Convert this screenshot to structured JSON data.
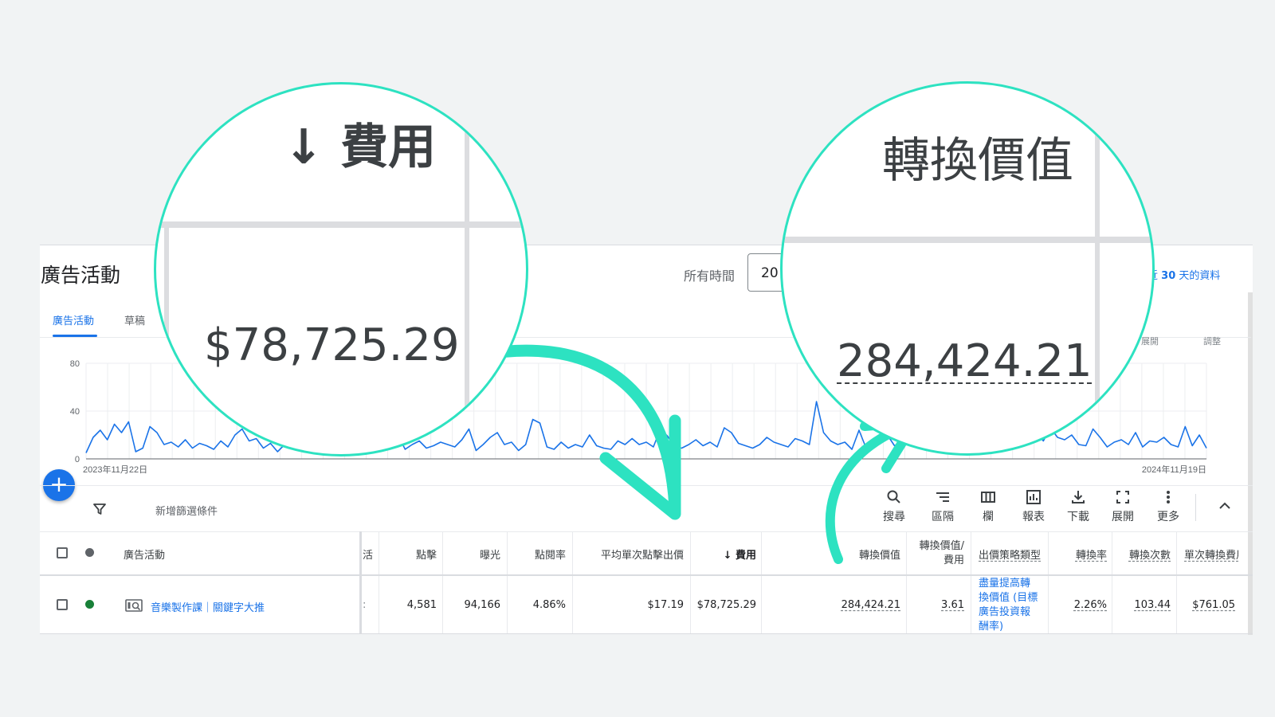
{
  "header": {
    "title": "廣告活動",
    "date_label": "所有時間",
    "date_value": "20",
    "data_note_prefix": "近",
    "data_note_days": "30",
    "data_note_suffix": "天的資料"
  },
  "tabs": [
    {
      "label": "廣告活動",
      "active": true
    },
    {
      "label": "草稿",
      "active": false
    }
  ],
  "chart_hints": [
    "展開",
    "調整"
  ],
  "chart_data": {
    "type": "line",
    "yticks": [
      "80",
      "40",
      "0"
    ],
    "ylim": [
      0,
      80
    ],
    "x_start_label": "2023年11月22日",
    "x_end_label": "2024年11月19日",
    "series_color": "#1a73e8",
    "series": [
      {
        "values": [
          5,
          18,
          24,
          16,
          29,
          22,
          31,
          6,
          9,
          27,
          22,
          12,
          14,
          10,
          16,
          9,
          13,
          11,
          8,
          15,
          10,
          20,
          25,
          15,
          17,
          9,
          13,
          6,
          12,
          26,
          29,
          27,
          10,
          8,
          11,
          15,
          12,
          9,
          14,
          10,
          16,
          12,
          11,
          13,
          20,
          8,
          12,
          15,
          9,
          11,
          14,
          12,
          10,
          16,
          25,
          7,
          12,
          18,
          22,
          12,
          14,
          7,
          12,
          33,
          30,
          10,
          8,
          14,
          9,
          12,
          10,
          20,
          11,
          9,
          8,
          15,
          12,
          17,
          12,
          14,
          10,
          25,
          19,
          10,
          9,
          12,
          16,
          11,
          14,
          10,
          26,
          22,
          13,
          11,
          9,
          12,
          18,
          14,
          12,
          10,
          17,
          15,
          12,
          48,
          22,
          15,
          12,
          14,
          8,
          24,
          9,
          12,
          13,
          20,
          11,
          14,
          16,
          27,
          21,
          19,
          9,
          15,
          25,
          17,
          14,
          10,
          12,
          20,
          14,
          8,
          13,
          35,
          24,
          18,
          22,
          15,
          26,
          18,
          16,
          20,
          12,
          11,
          25,
          18,
          10,
          14,
          16,
          12,
          22,
          10,
          15,
          14,
          18,
          12,
          10,
          27,
          11,
          20,
          9
        ]
      }
    ]
  },
  "fab_label": "+",
  "filter": {
    "label": "新增篩選條件"
  },
  "toolbar": [
    {
      "label": "搜尋",
      "icon": "search-icon"
    },
    {
      "label": "區隔",
      "icon": "segment-icon"
    },
    {
      "label": "欄",
      "icon": "columns-icon"
    },
    {
      "label": "報表",
      "icon": "reports-icon"
    },
    {
      "label": "下載",
      "icon": "download-icon"
    },
    {
      "label": "展開",
      "icon": "fullscreen-icon"
    },
    {
      "label": "更多",
      "icon": "more-icon"
    }
  ],
  "table": {
    "headers": {
      "campaign": "廣告活動",
      "truncated": "活",
      "clicks": "點擊",
      "impressions": "曝光",
      "ctr": "點閱率",
      "avg_cpc": "平均單次點擊出價",
      "cost": "↓ 費用",
      "conv_value": "轉換價值",
      "conv_value_cost_1": "轉換價值/",
      "conv_value_cost_2": "費用",
      "bid_strategy": "出價策略類型",
      "conv_rate": "轉換率",
      "conversions": "轉換次數",
      "cost_per_conv": "單次轉換費用"
    },
    "row": {
      "campaign": "音樂製作課｜關鍵字大推",
      "status_color": "#188038",
      "clicks": "4,581",
      "impressions": "94,166",
      "ctr": "4.86%",
      "avg_cpc": "$17.19",
      "cost": "$78,725.29",
      "conv_value": "284,424.21",
      "conv_value_cost": "3.61",
      "bid_strategy_lines": [
        "盡量提高轉",
        "換價值 (目標",
        "廣告投資報",
        "酬率)"
      ],
      "conv_rate": "2.26%",
      "conversions": "103.44",
      "cost_per_conv": "$761.05"
    }
  },
  "magnifiers": {
    "left": {
      "title": "↓ 費用",
      "value": "$78,725.29"
    },
    "right": {
      "title": "轉換價值",
      "value": "284,424.21"
    }
  },
  "accent_color": "#2de2c1"
}
